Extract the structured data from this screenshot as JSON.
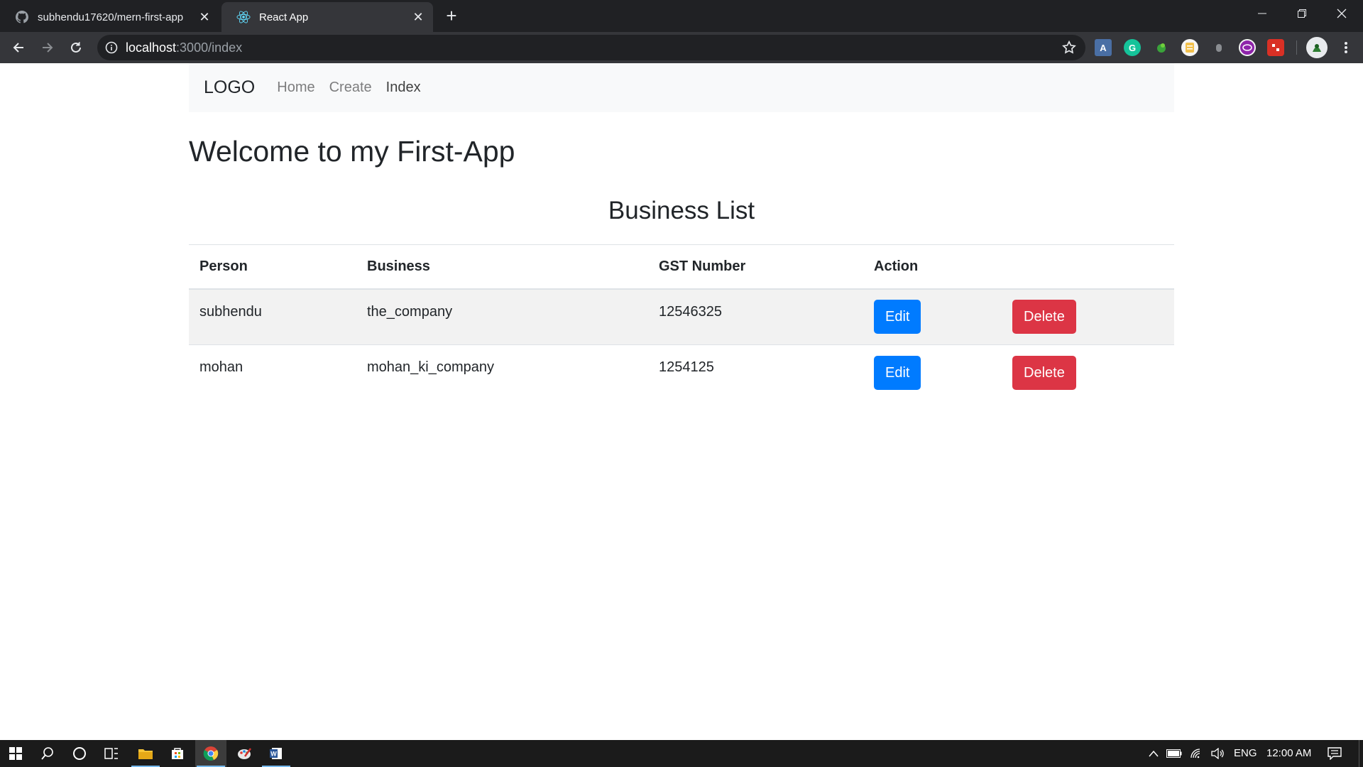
{
  "browser": {
    "tabs": [
      {
        "title": "subhendu17620/mern-first-app",
        "active": false,
        "icon": "github-icon"
      },
      {
        "title": "React App",
        "active": true,
        "icon": "react-icon"
      }
    ],
    "url_host": "localhost",
    "url_path": ":3000/index",
    "extensions": [
      "extension-a-icon",
      "grammarly-icon",
      "extension-green-icon",
      "extension-notes-icon",
      "extension-gray-icon",
      "extension-purple-icon",
      "extension-red-icon"
    ]
  },
  "page": {
    "navbar": {
      "brand": "LOGO",
      "links": [
        "Home",
        "Create",
        "Index"
      ]
    },
    "welcome": "Welcome to my First-App",
    "list_title": "Business List",
    "table": {
      "headers": [
        "Person",
        "Business",
        "GST Number",
        "Action"
      ],
      "rows": [
        {
          "person": "subhendu",
          "business": "the_company",
          "gst": "12546325",
          "edit": "Edit",
          "delete": "Delete"
        },
        {
          "person": "mohan",
          "business": "mohan_ki_company",
          "gst": "1254125",
          "edit": "Edit",
          "delete": "Delete"
        }
      ]
    }
  },
  "taskbar": {
    "language": "ENG",
    "time": "12:00 AM"
  },
  "colors": {
    "edit": "#007bff",
    "delete": "#dc3545",
    "navbar_bg": "#f8f9fa",
    "chrome_dark": "#202124",
    "chrome_toolbar": "#35363a"
  }
}
